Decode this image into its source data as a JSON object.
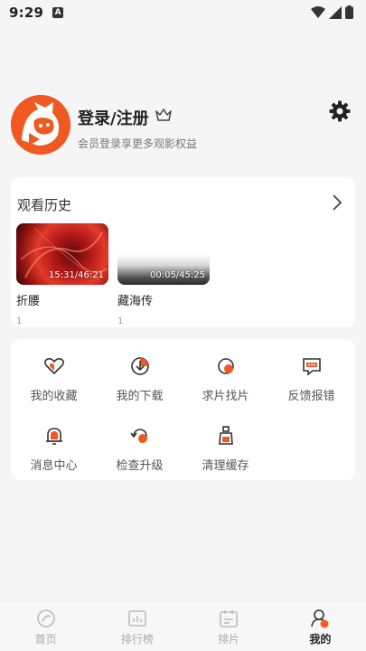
{
  "status_bar": {
    "time": "9:29",
    "notification_glyph": "A",
    "icons": [
      "wifi-icon",
      "signal-icon",
      "battery-icon"
    ]
  },
  "profile": {
    "title": "登录/注册",
    "subtitle": "会员登录享更多观影权益",
    "avatar_color": "#f05a22",
    "icons": [
      "crown-icon",
      "gear-icon"
    ]
  },
  "history": {
    "title": "观看历史",
    "items": [
      {
        "name": "折腰",
        "time": "15:31/46:21",
        "episode": "1"
      },
      {
        "name": "藏海传",
        "time": "00:05/45:25",
        "episode": "1"
      }
    ]
  },
  "menu": {
    "items": [
      {
        "label": "我的收藏",
        "icon": "heart-icon"
      },
      {
        "label": "我的下载",
        "icon": "download-icon"
      },
      {
        "label": "求片找片",
        "icon": "search-film-icon"
      },
      {
        "label": "反馈报错",
        "icon": "feedback-icon"
      },
      {
        "label": "消息中心",
        "icon": "bell-icon"
      },
      {
        "label": "检查升级",
        "icon": "upgrade-icon"
      },
      {
        "label": "清理缓存",
        "icon": "clean-cache-icon"
      }
    ]
  },
  "tabbar": {
    "tabs": [
      {
        "label": "首页",
        "icon": "home-icon"
      },
      {
        "label": "排行榜",
        "icon": "ranking-icon"
      },
      {
        "label": "排片",
        "icon": "schedule-icon"
      },
      {
        "label": "我的",
        "icon": "profile-icon"
      }
    ],
    "active": "我的"
  },
  "colors": {
    "accent": "#f05a22",
    "background": "#f5f5f5",
    "card": "#ffffff"
  }
}
